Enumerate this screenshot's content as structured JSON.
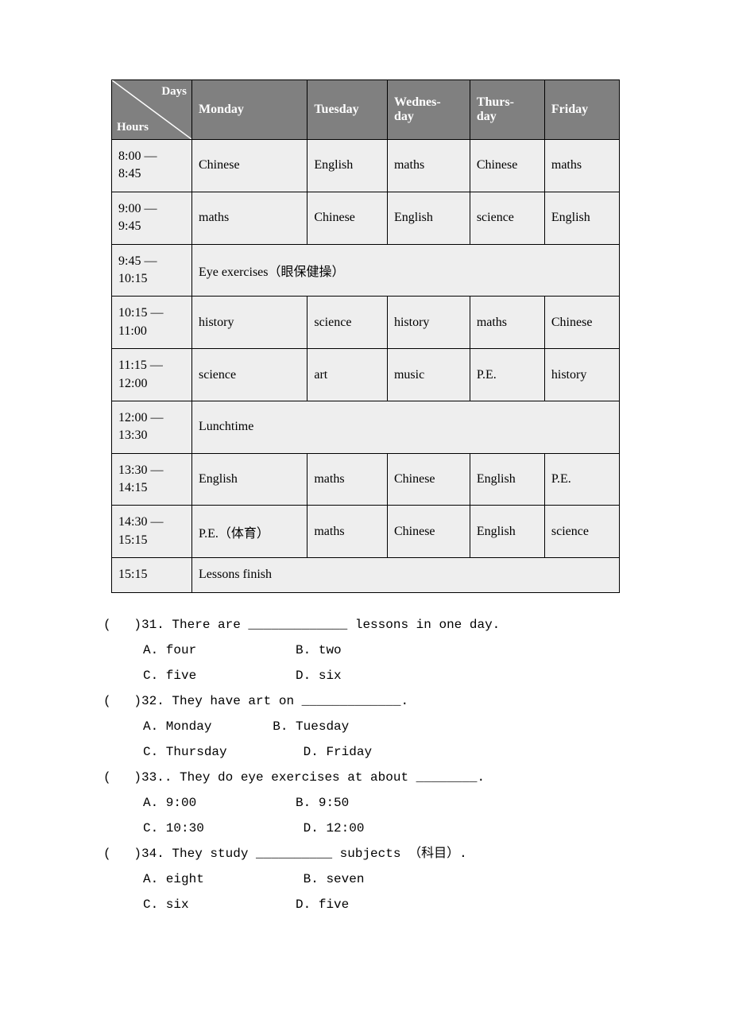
{
  "corner": {
    "days": "Days",
    "hours": "Hours"
  },
  "headers": {
    "mon": "Monday",
    "tue": "Tuesday",
    "wed": "Wednes-\nday",
    "thu": "Thurs-\nday",
    "fri": "Friday"
  },
  "times": {
    "r1": "8:00   —\n8:45",
    "r2": "9:00   —\n9:45",
    "r3": "9:45   —\n10:15",
    "r4": "10:15 —\n11:00",
    "r5": "11:15 —\n12:00",
    "r6": "12:00 —\n13:30",
    "r7": "13:30 —\n14:15",
    "r8": "14:30 —\n15:15",
    "r9": "15:15"
  },
  "cells": {
    "r1": [
      "Chinese",
      "English",
      "maths",
      "Chinese",
      "maths"
    ],
    "r2": [
      "maths",
      "Chinese",
      "English",
      "science",
      "English"
    ],
    "r3span": "Eye exercises（眼保健操）",
    "r4": [
      "history",
      "science",
      "history",
      "maths",
      "Chinese"
    ],
    "r5": [
      "science",
      "art",
      "music",
      "P.E.",
      "history"
    ],
    "r6span": "Lunchtime",
    "r7": [
      "English",
      "maths",
      "Chinese",
      "English",
      "P.E."
    ],
    "r8": [
      "P.E.（体育）",
      "maths",
      "Chinese",
      "English",
      "science"
    ],
    "r9span": "Lessons finish"
  },
  "chart_data": {
    "type": "table",
    "title": "Class timetable",
    "columns": [
      "Monday",
      "Tuesday",
      "Wednesday",
      "Thursday",
      "Friday"
    ],
    "rows": [
      {
        "time": "8:00—8:45",
        "Monday": "Chinese",
        "Tuesday": "English",
        "Wednesday": "maths",
        "Thursday": "Chinese",
        "Friday": "maths"
      },
      {
        "time": "9:00—9:45",
        "Monday": "maths",
        "Tuesday": "Chinese",
        "Wednesday": "English",
        "Thursday": "science",
        "Friday": "English"
      },
      {
        "time": "9:45—10:15",
        "span": "Eye exercises（眼保健操）"
      },
      {
        "time": "10:15—11:00",
        "Monday": "history",
        "Tuesday": "science",
        "Wednesday": "history",
        "Thursday": "maths",
        "Friday": "Chinese"
      },
      {
        "time": "11:15—12:00",
        "Monday": "science",
        "Tuesday": "art",
        "Wednesday": "music",
        "Thursday": "P.E.",
        "Friday": "history"
      },
      {
        "time": "12:00—13:30",
        "span": "Lunchtime"
      },
      {
        "time": "13:30—14:15",
        "Monday": "English",
        "Tuesday": "maths",
        "Wednesday": "Chinese",
        "Thursday": "English",
        "Friday": "P.E."
      },
      {
        "time": "14:30—15:15",
        "Monday": "P.E.（体育）",
        "Tuesday": "maths",
        "Wednesday": "Chinese",
        "Thursday": "English",
        "Friday": "science"
      },
      {
        "time": "15:15",
        "span": "Lessons finish"
      }
    ]
  },
  "questions": {
    "q31": {
      "stem": "(   )31. There are _____________ lessons in one day.",
      "optA": "A. four             B. two",
      "optB": "C. five             D. six"
    },
    "q32": {
      "stem": "(   )32. They have art on _____________.",
      "optA": "A. Monday        B. Tuesday",
      "optB": "C. Thursday          D. Friday"
    },
    "q33": {
      "stem": "(   )33.. They do eye exercises at about ________.",
      "optA": "A. 9:00             B. 9:50",
      "optB": "C. 10:30             D. 12:00"
    },
    "q34": {
      "stem": "(   )34. They study __________ subjects （科目）.",
      "optA": "A. eight             B. seven",
      "optB": "C. six              D. five"
    }
  }
}
